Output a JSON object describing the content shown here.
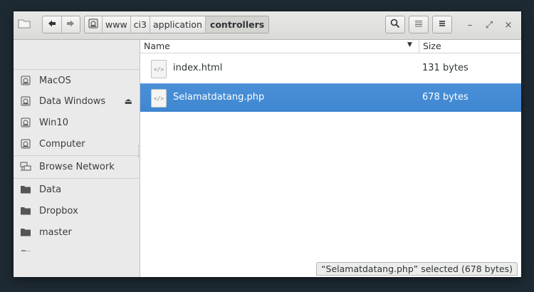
{
  "header": {
    "sidebar_toggle_icon": "folder-icon",
    "back_icon": "arrow-left-icon",
    "forward_icon": "arrow-right-icon",
    "path": {
      "drive_icon": "drive-icon",
      "segments": [
        "www",
        "ci3",
        "application",
        "controllers"
      ]
    },
    "search_icon": "search-icon",
    "list_view_icon": "list-icon",
    "menu_icon": "hamburger-icon",
    "minimize": "–",
    "maximize": "⤢",
    "close": "×"
  },
  "sidebar": {
    "devices": [
      {
        "label": "MacOS",
        "icon": "drive-icon"
      },
      {
        "label": "Data Windows",
        "icon": "drive-icon",
        "eject": "⏏"
      },
      {
        "label": "Win10",
        "icon": "drive-icon"
      },
      {
        "label": "Computer",
        "icon": "drive-icon"
      }
    ],
    "network": {
      "label": "Browse Network",
      "icon": "network-icon"
    },
    "bookmarks": [
      {
        "label": "Data",
        "icon": "folder-icon"
      },
      {
        "label": "Dropbox",
        "icon": "folder-icon"
      },
      {
        "label": "master",
        "icon": "folder-icon"
      }
    ]
  },
  "list": {
    "columns": {
      "name": "Name",
      "size": "Size"
    },
    "rows": [
      {
        "name": "index.html",
        "size": "131 bytes",
        "icon": "code-file-icon",
        "selected": false
      },
      {
        "name": "Selamatdatang.php",
        "size": "678 bytes",
        "icon": "code-file-icon",
        "selected": true
      }
    ]
  },
  "status": {
    "text": "“Selamatdatang.php” selected (678 bytes)"
  },
  "colors": {
    "selection": "#4a90d9",
    "sidebar_bg": "#eaeaea",
    "desktop_bg": "#1e2a33"
  }
}
